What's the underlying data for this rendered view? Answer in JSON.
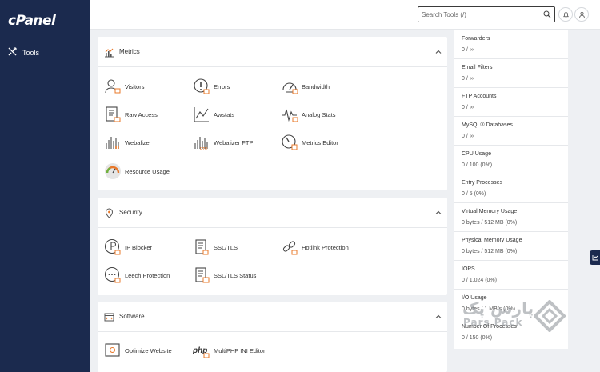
{
  "brand": {
    "logo": "cPanel"
  },
  "sidebar": {
    "items": [
      {
        "label": "Tools",
        "icon": "tools-icon"
      }
    ]
  },
  "topbar": {
    "search": {
      "placeholder": "Search Tools (/)",
      "value": ""
    },
    "notifications_icon": "bell-icon",
    "user_icon": "user-icon"
  },
  "sections": [
    {
      "title": "Metrics",
      "icon": "metrics-icon",
      "items": [
        {
          "label": "Visitors",
          "icon": "visitors-icon"
        },
        {
          "label": "Errors",
          "icon": "errors-icon"
        },
        {
          "label": "Bandwidth",
          "icon": "bandwidth-icon"
        },
        {
          "label": "Raw Access",
          "icon": "raw-access-icon"
        },
        {
          "label": "Awstats",
          "icon": "awstats-icon"
        },
        {
          "label": "Analog Stats",
          "icon": "analog-stats-icon"
        },
        {
          "label": "Webalizer",
          "icon": "webalizer-icon"
        },
        {
          "label": "Webalizer FTP",
          "icon": "webalizer-ftp-icon"
        },
        {
          "label": "Metrics Editor",
          "icon": "metrics-editor-icon"
        },
        {
          "label": "Resource Usage",
          "icon": "resource-usage-icon"
        }
      ]
    },
    {
      "title": "Security",
      "icon": "security-icon",
      "items": [
        {
          "label": "IP Blocker",
          "icon": "ip-blocker-icon"
        },
        {
          "label": "SSL/TLS",
          "icon": "ssl-tls-icon"
        },
        {
          "label": "Hotlink Protection",
          "icon": "hotlink-protection-icon"
        },
        {
          "label": "Leech Protection",
          "icon": "leech-protection-icon"
        },
        {
          "label": "SSL/TLS Status",
          "icon": "ssl-tls-status-icon"
        }
      ]
    },
    {
      "title": "Software",
      "icon": "software-icon",
      "items": [
        {
          "label": "Optimize Website",
          "icon": "optimize-website-icon"
        },
        {
          "label": "MultiPHP INI Editor",
          "icon": "multiphp-ini-editor-icon"
        }
      ]
    }
  ],
  "stats": [
    {
      "label": "Forwarders",
      "value": "0 / ∞"
    },
    {
      "label": "Email Filters",
      "value": "0 / ∞"
    },
    {
      "label": "FTP Accounts",
      "value": "0 / ∞"
    },
    {
      "label": "MySQL® Databases",
      "value": "0 / ∞"
    },
    {
      "label": "CPU Usage",
      "value": "0 / 100   (0%)"
    },
    {
      "label": "Entry Processes",
      "value": "0 / 5   (0%)"
    },
    {
      "label": "Virtual Memory Usage",
      "value": "0 bytes / 512 MB   (0%)"
    },
    {
      "label": "Physical Memory Usage",
      "value": "0 bytes / 512 MB   (0%)"
    },
    {
      "label": "IOPS",
      "value": "0 / 1,024   (0%)"
    },
    {
      "label": "I/O Usage",
      "value": "0 bytes / 1 MB/s   (0%)"
    },
    {
      "label": "Number Of Processes",
      "value": "0 / 150   (0%)"
    }
  ],
  "watermark": {
    "text": "پارس پک",
    "subtext": "Pars Pack"
  },
  "colors": {
    "sidebar": "#1b2a4e",
    "background": "#eef0f3",
    "accent_orange": "#e8782a"
  }
}
